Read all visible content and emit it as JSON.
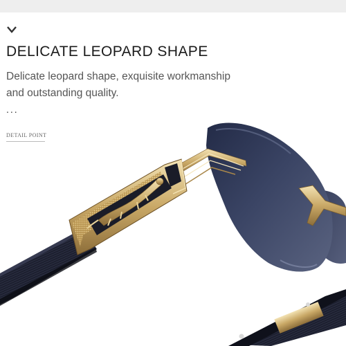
{
  "headline": "DELICATE LEOPARD SHAPE",
  "description": {
    "line1": "Delicate leopard shape, exquisite workmanship",
    "line2": "and outstanding quality."
  },
  "ellipsis": "...",
  "detail_label": "DETAIL POINT",
  "icons": {
    "chevron": "chevron-down-icon"
  },
  "colors": {
    "lens": "#2c3552",
    "gold": "#c9a866",
    "temple_wood": "#1c1f2e"
  }
}
